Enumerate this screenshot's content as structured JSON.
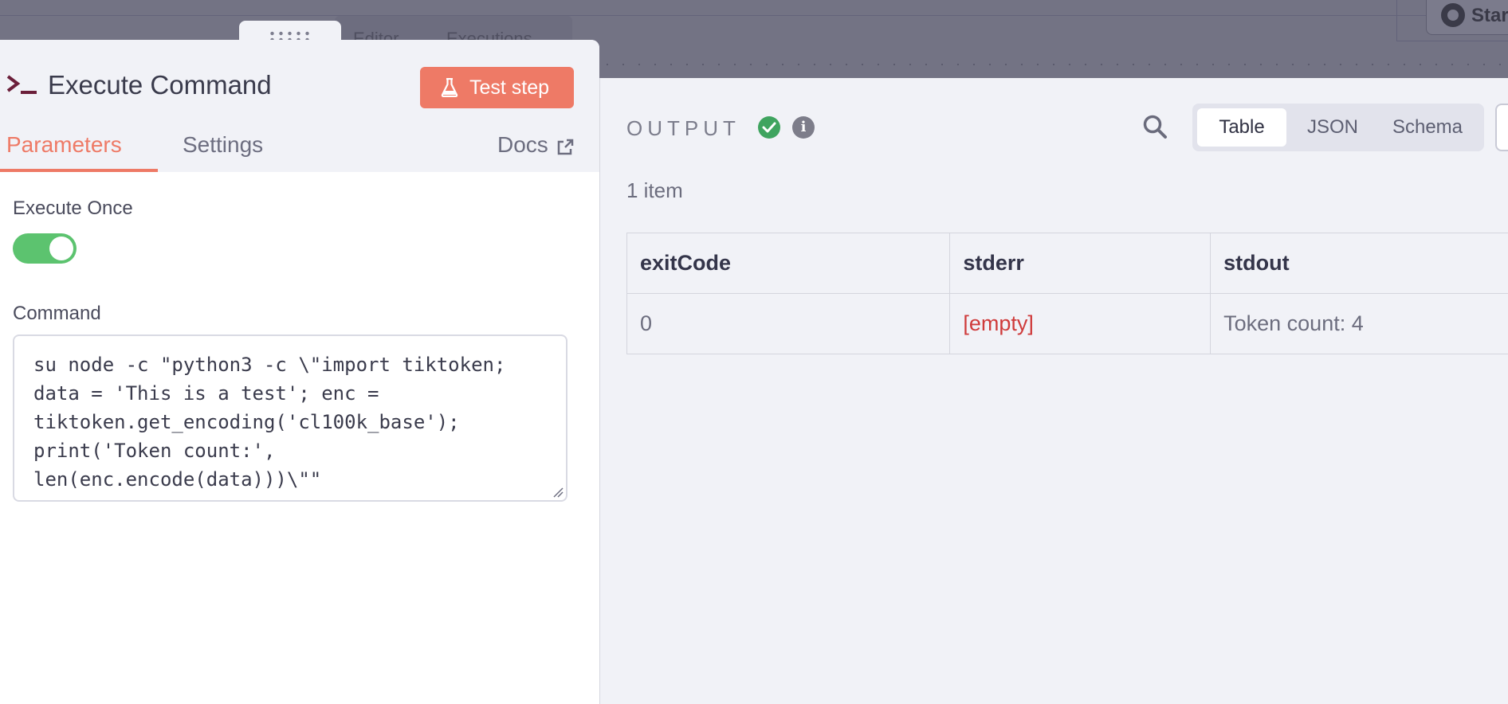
{
  "background": {
    "tabs": [
      "Editor",
      "Executions"
    ],
    "github_label": "Star"
  },
  "node": {
    "title": "Execute Command",
    "test_button": "Test step",
    "tabs": {
      "parameters": "Parameters",
      "settings": "Settings",
      "docs": "Docs"
    },
    "execute_once": {
      "label": "Execute Once",
      "enabled": true
    },
    "command": {
      "label": "Command",
      "value": "su node -c \"python3 -c \\\"import tiktoken; data = 'This is a test'; enc = tiktoken.get_encoding('cl100k_base'); print('Token count:', len(enc.encode(data)))\\\"\""
    }
  },
  "output": {
    "title": "OUTPUT",
    "views": [
      "Table",
      "JSON",
      "Schema"
    ],
    "active_view": "Table",
    "item_count": "1 item",
    "columns": [
      "exitCode",
      "stderr",
      "stdout"
    ],
    "rows": [
      [
        "0",
        "[empty]",
        "Token count: 4"
      ]
    ]
  },
  "colors": {
    "accent": "#ee7a66",
    "toggle_on": "#5cc36f",
    "success": "#3fa45f",
    "empty_value": "#cf3b3b"
  }
}
